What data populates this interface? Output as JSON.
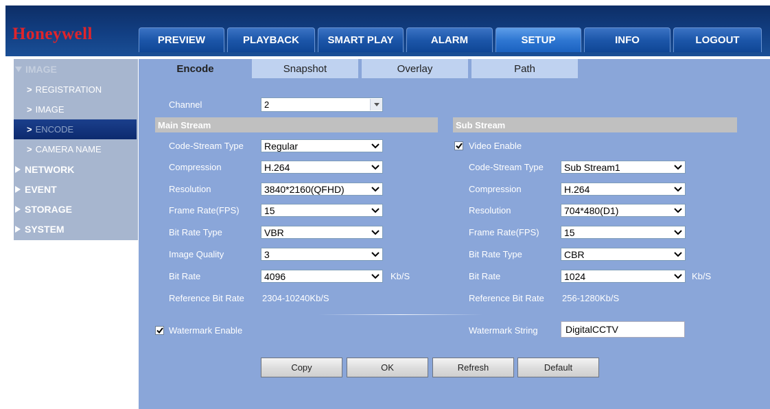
{
  "header": {
    "logo": "Honeywell",
    "nav": [
      {
        "label": "PREVIEW",
        "active": false
      },
      {
        "label": "PLAYBACK",
        "active": false
      },
      {
        "label": "SMART PLAY",
        "active": false
      },
      {
        "label": "ALARM",
        "active": false
      },
      {
        "label": "SETUP",
        "active": true
      },
      {
        "label": "INFO",
        "active": false
      },
      {
        "label": "LOGOUT",
        "active": false
      }
    ]
  },
  "sidebar": {
    "image_head": "IMAGE",
    "sub_items": [
      "REGISTRATION",
      "IMAGE",
      "ENCODE",
      "CAMERA NAME"
    ],
    "selected_sub": "ENCODE",
    "top_items": [
      "NETWORK",
      "EVENT",
      "STORAGE",
      "SYSTEM"
    ]
  },
  "tabs": [
    "Encode",
    "Snapshot",
    "Overlay",
    "Path"
  ],
  "active_tab": "Encode",
  "channel": {
    "label": "Channel",
    "value": "2"
  },
  "main_stream": {
    "title": "Main Stream",
    "fields": [
      {
        "label": "Code-Stream Type",
        "value": "Regular"
      },
      {
        "label": "Compression",
        "value": "H.264"
      },
      {
        "label": "Resolution",
        "value": "3840*2160(QFHD)"
      },
      {
        "label": "Frame Rate(FPS)",
        "value": "15"
      },
      {
        "label": "Bit Rate Type",
        "value": "VBR"
      },
      {
        "label": "Image Quality",
        "value": "3"
      },
      {
        "label": "Bit Rate",
        "value": "4096",
        "unit": "Kb/S"
      }
    ],
    "ref_label": "Reference Bit Rate",
    "ref_value": "2304-10240Kb/S"
  },
  "sub_stream": {
    "title": "Sub Stream",
    "video_enable_label": "Video Enable",
    "video_enable_checked": true,
    "fields": [
      {
        "label": "Code-Stream Type",
        "value": "Sub Stream1"
      },
      {
        "label": "Compression",
        "value": "H.264"
      },
      {
        "label": "Resolution",
        "value": "704*480(D1)"
      },
      {
        "label": "Frame Rate(FPS)",
        "value": "15"
      },
      {
        "label": "Bit Rate Type",
        "value": "CBR"
      },
      {
        "label": "Bit Rate",
        "value": "1024",
        "unit": "Kb/S"
      }
    ],
    "ref_label": "Reference Bit Rate",
    "ref_value": "256-1280Kb/S"
  },
  "watermark": {
    "enable_label": "Watermark Enable",
    "enable_checked": true,
    "string_label": "Watermark String",
    "string_value": "DigitalCCTV"
  },
  "buttons": {
    "copy": "Copy",
    "ok": "OK",
    "refresh": "Refresh",
    "default": "Default"
  },
  "colors": {
    "header": "#123f83",
    "panel": "#8aa6d9",
    "sidebar": "#a7b6cf",
    "logo": "#e0242b"
  }
}
